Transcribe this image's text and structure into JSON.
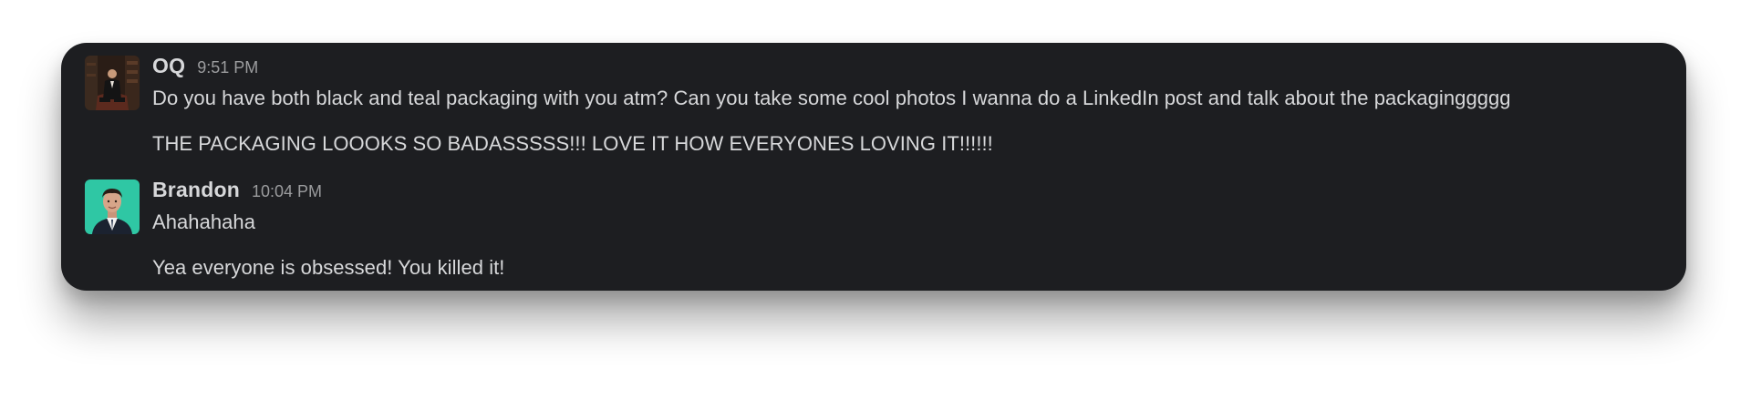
{
  "messages": [
    {
      "author": "OQ",
      "time": "9:51 PM",
      "avatar_icon": "dark-portrait-avatar",
      "lines": [
        "Do you have both black and teal packaging with you atm? Can you take some cool photos I wanna do a LinkedIn post and talk about the packaginggggg",
        "THE PACKAGING LOOOKS SO BADASSSSS!!! LOVE IT HOW EVERYONES LOVING IT!!!!!!"
      ]
    },
    {
      "author": "Brandon",
      "time": "10:04 PM",
      "avatar_icon": "teal-portrait-avatar",
      "lines": [
        "Ahahahaha",
        "Yea everyone is obsessed! You killed it!"
      ]
    }
  ],
  "colors": {
    "card_background": "#1d1e21",
    "text": "#d7d8da",
    "timestamp": "#9b9c9e",
    "brandon_avatar_bg": "#2fc7a4"
  }
}
